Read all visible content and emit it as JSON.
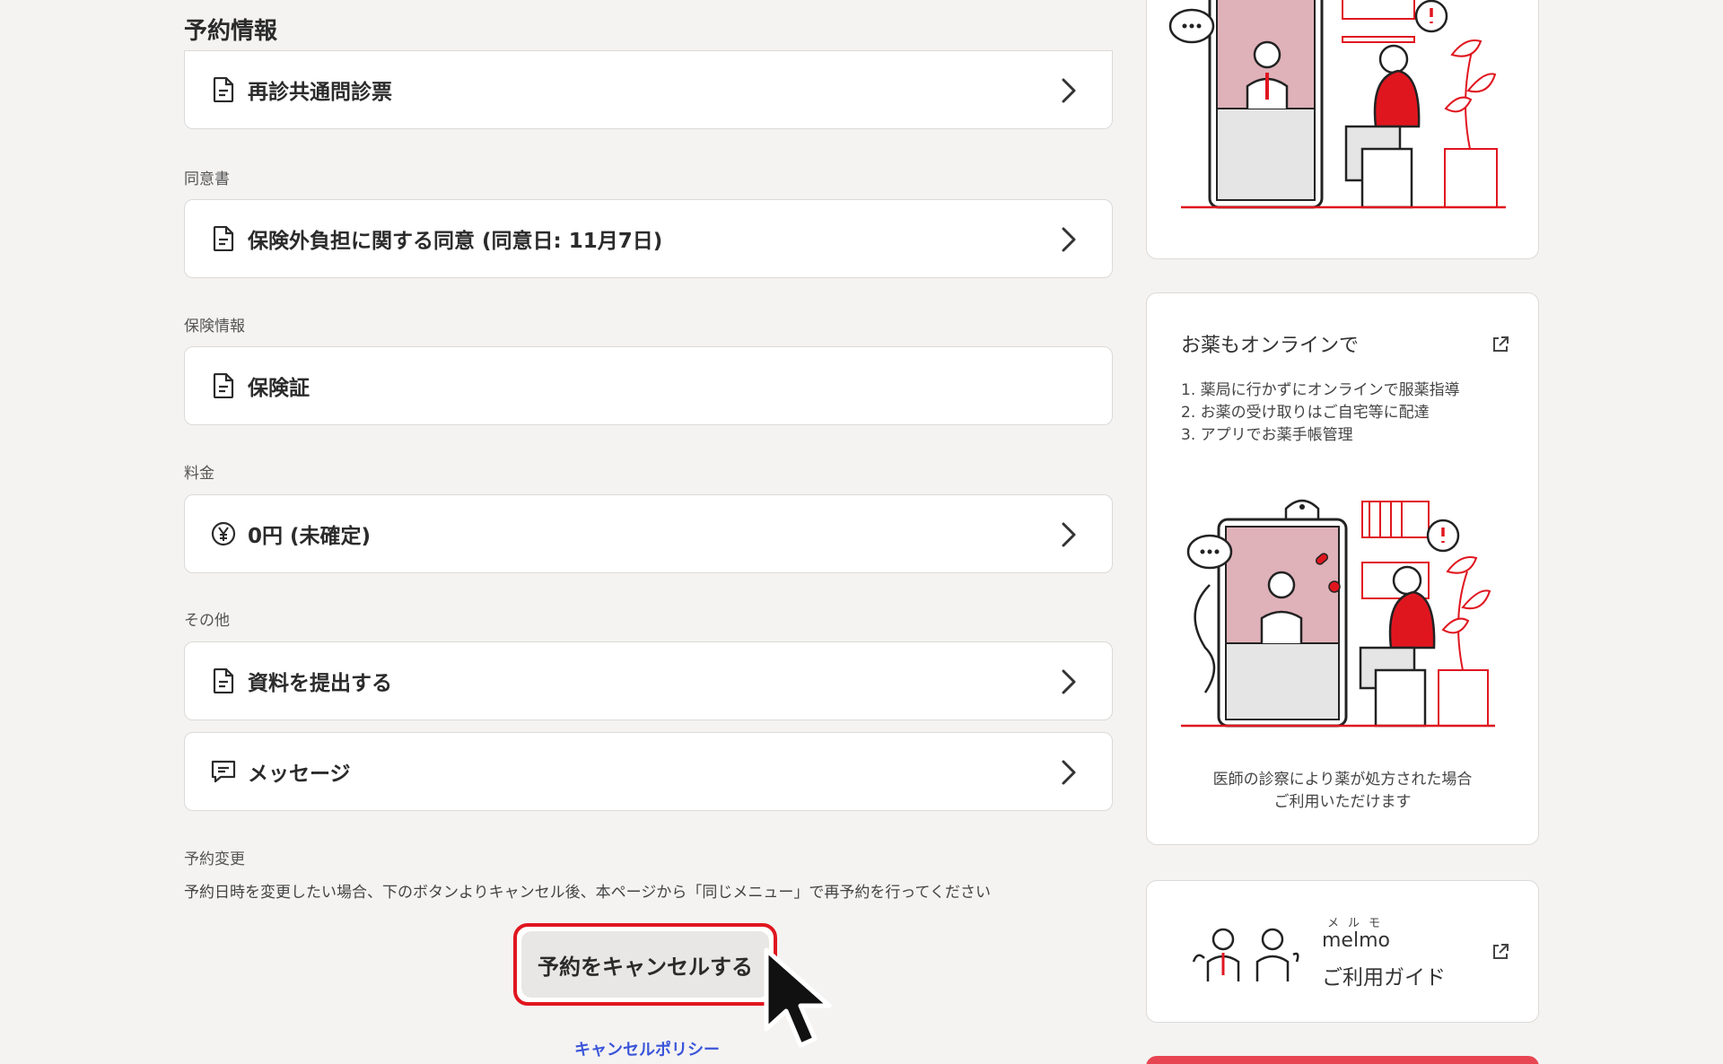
{
  "main": {
    "section_title": "予約情報",
    "cards": {
      "questionnaire": "再診共通問診票",
      "consent": "保険外負担に関する同意 (同意日: 11月7日)",
      "insurance": "保険証",
      "fee": "0円 (未確定)",
      "submit_docs": "資料を提出する",
      "message": "メッセージ"
    },
    "labels": {
      "consent": "同意書",
      "insurance": "保険情報",
      "fee": "料金",
      "other": "その他",
      "change": "予約変更"
    },
    "change_description": "予約日時を変更したい場合、下のボタンよりキャンセル後、本ページから「同じメニュー」で再予約を行ってください",
    "cancel_button": "予約をキャンセルする",
    "cancel_policy": "キャンセルポリシー"
  },
  "side": {
    "pharmacy": {
      "title": "お薬もオンラインで",
      "items": [
        "1. 薬局に行かずにオンラインで服薬指導",
        "2. お薬の受け取りはご自宅等に配達",
        "3. アプリでお薬手帳管理"
      ],
      "caption_line1": "医師の診察により薬が処方された場合",
      "caption_line2": "ご利用いただけます"
    },
    "melmo": {
      "ruby": "メルモ",
      "name": "melmo",
      "guide": "ご利用ガイド"
    }
  },
  "colors": {
    "accent_red": "#e0161f",
    "link_blue": "#3b55d9",
    "background": "#f4f3f2"
  },
  "icons": [
    "document-icon",
    "yen-icon",
    "message-icon",
    "chevron-right-icon",
    "external-link-icon",
    "cursor-icon"
  ]
}
